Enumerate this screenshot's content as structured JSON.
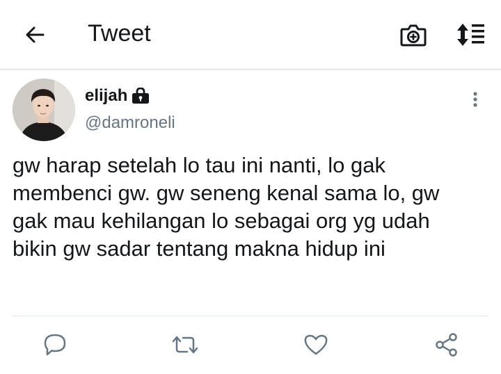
{
  "header": {
    "title": "Tweet",
    "back_icon": "arrow-left-icon",
    "camera_icon": "camera-add-icon",
    "sort_icon": "sort-list-icon"
  },
  "tweet": {
    "display_name": "elijah",
    "protected_icon": "lock-icon",
    "handle": "@damroneli",
    "text": "gw harap setelah lo tau ini nanti, lo gak\nmembenci gw. gw seneng kenal sama lo, gw\ngak mau kehilangan lo sebagai org yg udah\nbikin gw sadar tentang makna hidup ini",
    "more_icon": "more-vertical-icon"
  },
  "actions": [
    {
      "name": "reply",
      "icon": "reply-icon"
    },
    {
      "name": "retweet",
      "icon": "retweet-icon"
    },
    {
      "name": "like",
      "icon": "heart-icon"
    },
    {
      "name": "share",
      "icon": "share-icon"
    }
  ],
  "colors": {
    "text_primary": "#14171a",
    "text_secondary": "#657786",
    "icon": "#657786",
    "divider": "#e1e8ed"
  }
}
